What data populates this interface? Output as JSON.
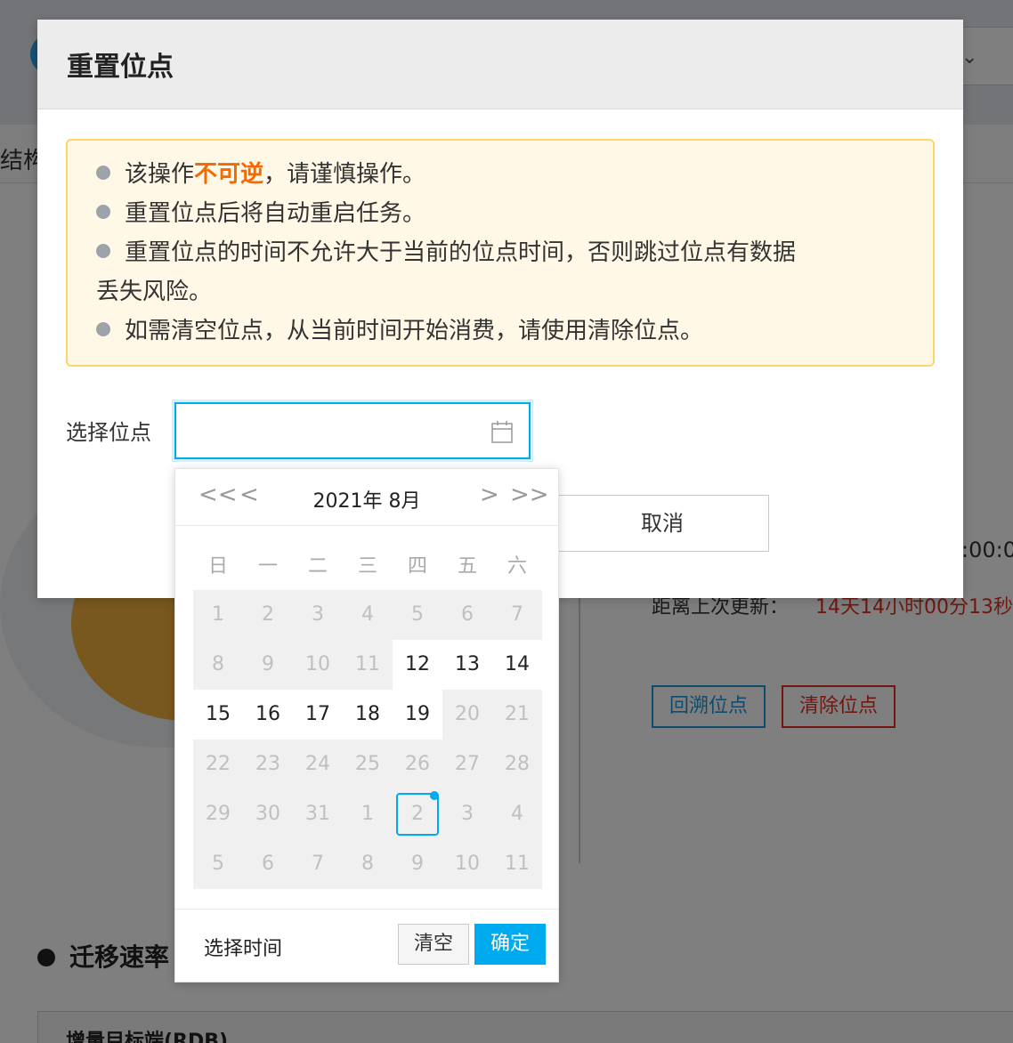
{
  "background": {
    "tab_label": "结构",
    "time_partial": ":00:0",
    "distance_label": "距离上次更新：",
    "distance_value": "14天14小时00分13秒",
    "btn_rollback": "回溯位点",
    "btn_clear_offset": "清除位点",
    "section_title": "迁移速率",
    "panel_title": "增量目标端(RDB)"
  },
  "modal": {
    "title": "重置位点",
    "alert": {
      "line1_prefix": "该操作",
      "line1_warn": "不可逆",
      "line1_suffix": "，请谨慎操作。",
      "line2": "重置位点后将自动重启任务。",
      "line3a": "重置位点的时间不允许大于当前的位点时间，否则跳过位点有数据",
      "line3b": "丢失风险。",
      "line4": "如需清空位点，从当前时间开始消费，请使用清除位点。"
    },
    "form_label": "选择位点",
    "date_value": "",
    "cancel_label": "取消"
  },
  "picker": {
    "title": "2021年 8月",
    "nav": {
      "prev_year": "<<",
      "prev_month": "<",
      "next_month": ">",
      "next_year": ">>"
    },
    "weekdays": [
      "日",
      "一",
      "二",
      "三",
      "四",
      "五",
      "六"
    ],
    "weeks": [
      [
        {
          "d": "1",
          "s": "dis"
        },
        {
          "d": "2",
          "s": "dis"
        },
        {
          "d": "3",
          "s": "dis"
        },
        {
          "d": "4",
          "s": "dis"
        },
        {
          "d": "5",
          "s": "dis"
        },
        {
          "d": "6",
          "s": "dis"
        },
        {
          "d": "7",
          "s": "dis"
        }
      ],
      [
        {
          "d": "8",
          "s": "dis"
        },
        {
          "d": "9",
          "s": "dis"
        },
        {
          "d": "10",
          "s": "dis"
        },
        {
          "d": "11",
          "s": "dis"
        },
        {
          "d": "12",
          "s": "ok"
        },
        {
          "d": "13",
          "s": "ok"
        },
        {
          "d": "14",
          "s": "ok"
        }
      ],
      [
        {
          "d": "15",
          "s": "ok"
        },
        {
          "d": "16",
          "s": "ok"
        },
        {
          "d": "17",
          "s": "ok"
        },
        {
          "d": "18",
          "s": "ok"
        },
        {
          "d": "19",
          "s": "ok"
        },
        {
          "d": "20",
          "s": "dis"
        },
        {
          "d": "21",
          "s": "dis"
        }
      ],
      [
        {
          "d": "22",
          "s": "dis"
        },
        {
          "d": "23",
          "s": "dis"
        },
        {
          "d": "24",
          "s": "dis"
        },
        {
          "d": "25",
          "s": "dis"
        },
        {
          "d": "26",
          "s": "dis"
        },
        {
          "d": "27",
          "s": "dis"
        },
        {
          "d": "28",
          "s": "dis"
        }
      ],
      [
        {
          "d": "29",
          "s": "dis"
        },
        {
          "d": "30",
          "s": "dis"
        },
        {
          "d": "31",
          "s": "dis"
        },
        {
          "d": "1",
          "s": "dis"
        },
        {
          "d": "2",
          "s": "dis today"
        },
        {
          "d": "3",
          "s": "dis"
        },
        {
          "d": "4",
          "s": "dis"
        }
      ],
      [
        {
          "d": "5",
          "s": "dis"
        },
        {
          "d": "6",
          "s": "dis"
        },
        {
          "d": "7",
          "s": "dis"
        },
        {
          "d": "8",
          "s": "dis"
        },
        {
          "d": "9",
          "s": "dis"
        },
        {
          "d": "10",
          "s": "dis"
        },
        {
          "d": "11",
          "s": "dis"
        }
      ]
    ],
    "select_time": "选择时间",
    "clear": "清空",
    "confirm": "确定"
  },
  "colors": {
    "accent": "#00aaef",
    "warn": "#f56a00",
    "danger": "#e0301e"
  }
}
